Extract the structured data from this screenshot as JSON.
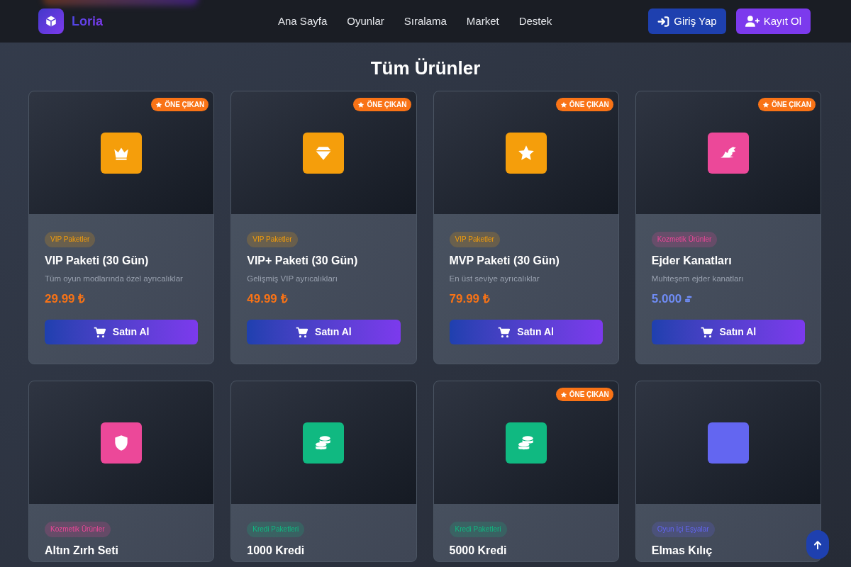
{
  "brand": {
    "name": "Loria"
  },
  "nav": {
    "links": [
      {
        "label": "Ana Sayfa"
      },
      {
        "label": "Oyunlar"
      },
      {
        "label": "Sıralama"
      },
      {
        "label": "Market"
      },
      {
        "label": "Destek"
      }
    ],
    "buttons": [
      {
        "kind": "login",
        "label": "Giriş Yap"
      },
      {
        "kind": "register",
        "label": "Kayıt Ol"
      }
    ]
  },
  "title": "Tüm Ürünler",
  "products": [
    {
      "badge": "ÖNE ÇIKAN",
      "kind": "crown",
      "color": "#f59e0b",
      "category": "VIP Paketler",
      "name": "VIP Paketi (30 Gün)",
      "description": "Tüm oyun modlarında özel ayrıcalıklar",
      "price": {
        "kind": "lira",
        "text": "29.99 ₺"
      },
      "button": "Satın Al"
    },
    {
      "badge": "ÖNE ÇIKAN",
      "kind": "gem",
      "color": "#f59e0b",
      "category": "VIP Paketler",
      "name": "VIP+ Paketi (30 Gün)",
      "description": "Gelişmiş VIP ayrıcalıkları",
      "price": {
        "kind": "lira",
        "text": "49.99 ₺"
      },
      "button": "Satın Al"
    },
    {
      "badge": "ÖNE ÇIKAN",
      "kind": "star",
      "color": "#f59e0b",
      "category": "VIP Paketler",
      "name": "MVP Paketi (30 Gün)",
      "description": "En üst seviye ayrıcalıklar",
      "price": {
        "kind": "lira",
        "text": "79.99 ₺"
      },
      "button": "Satın Al"
    },
    {
      "badge": "ÖNE ÇIKAN",
      "kind": "dragon",
      "color": "#ec4899",
      "category": "Kozmetik Ürünler",
      "name": "Ejder Kanatları",
      "description": "Muhteşem ejder kanatları",
      "price": {
        "kind": "credit",
        "text": "5.000"
      },
      "button": "Satın Al"
    },
    {
      "kind": "shield",
      "color": "#ec4899",
      "category": "Kozmetik Ürünler",
      "name": "Altın Zırh Seti"
    },
    {
      "kind": "coins",
      "color": "#10b981",
      "category": "Kredi Paketleri",
      "name": "1000 Kredi"
    },
    {
      "badge": "ÖNE ÇIKAN",
      "kind": "coins",
      "color": "#10b981",
      "category": "Kredi Paketleri",
      "name": "5000 Kredi"
    },
    {
      "kind": "blank",
      "color": "#6366f1",
      "category": "Oyun İçi Eşyalar",
      "name": "Elmas Kılıç"
    }
  ]
}
